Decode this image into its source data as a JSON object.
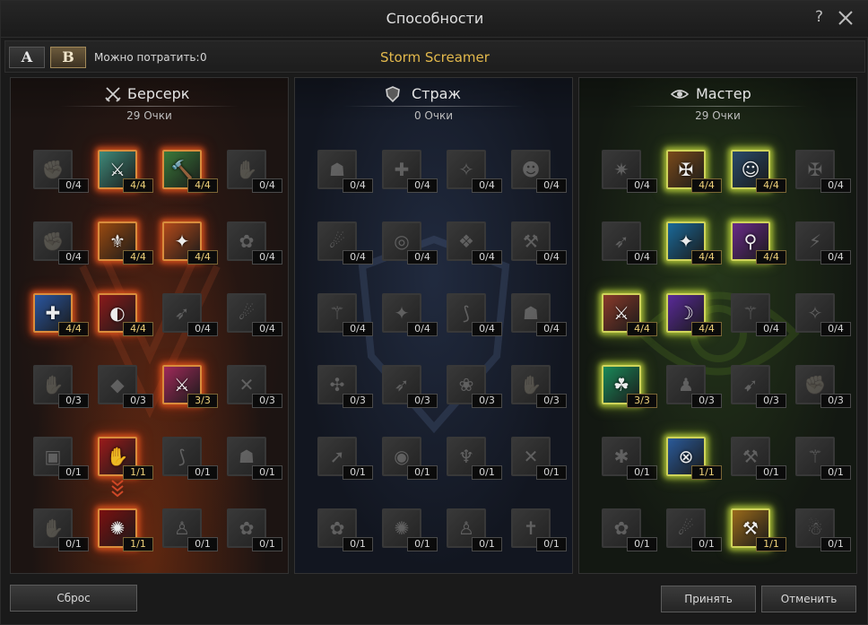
{
  "window": {
    "title": "Способности",
    "help": "?"
  },
  "toolbar": {
    "preset_a": "A",
    "preset_b": "B",
    "active_preset": "B",
    "spend_label": "Можно потратить:",
    "spend_value": "0",
    "spec_name": "Storm Screamer"
  },
  "panels": [
    {
      "key": "berserk",
      "title": "Берсерк",
      "points": "29 Очки",
      "emblem": "crossed-swords-icon",
      "accent": "#e0652a",
      "skills": [
        {
          "icon": "berserk-skill-1-icon",
          "glyph": "✊",
          "level": "0/4",
          "active": false
        },
        {
          "icon": "berserk-skill-2-icon",
          "glyph": "⚔",
          "level": "4/4",
          "active": true,
          "bg": "#3f8a7a"
        },
        {
          "icon": "berserk-skill-3-icon",
          "glyph": "🔨",
          "level": "4/4",
          "active": true,
          "bg": "#3a7a3a"
        },
        {
          "icon": "berserk-skill-4-icon",
          "glyph": "✋",
          "level": "0/4",
          "active": false
        },
        {
          "icon": "berserk-skill-5-icon",
          "glyph": "✊",
          "level": "0/4",
          "active": false
        },
        {
          "icon": "berserk-skill-6-icon",
          "glyph": "⚜",
          "level": "4/4",
          "active": true,
          "bg": "#9a4a10"
        },
        {
          "icon": "berserk-skill-7-icon",
          "glyph": "✦",
          "level": "4/4",
          "active": true,
          "bg": "#b34a1a"
        },
        {
          "icon": "berserk-skill-8-icon",
          "glyph": "✿",
          "level": "0/4",
          "active": false
        },
        {
          "icon": "berserk-skill-9-icon",
          "glyph": "✚",
          "level": "4/4",
          "active": true,
          "bg": "#2a56a0"
        },
        {
          "icon": "berserk-skill-10-icon",
          "glyph": "◐",
          "level": "4/4",
          "active": true,
          "bg": "#8a1a1a"
        },
        {
          "icon": "berserk-skill-11-icon",
          "glyph": "➶",
          "level": "0/4",
          "active": false
        },
        {
          "icon": "berserk-skill-12-icon",
          "glyph": "☄",
          "level": "0/4",
          "active": false
        },
        {
          "icon": "berserk-skill-13-icon",
          "glyph": "✋",
          "level": "0/3",
          "active": false
        },
        {
          "icon": "berserk-skill-14-icon",
          "glyph": "◆",
          "level": "0/3",
          "active": false
        },
        {
          "icon": "berserk-skill-15-icon",
          "glyph": "⚔",
          "level": "3/3",
          "active": true,
          "bg": "#a02a5a"
        },
        {
          "icon": "berserk-skill-16-icon",
          "glyph": "✕",
          "level": "0/3",
          "active": false
        },
        {
          "icon": "berserk-skill-17-icon",
          "glyph": "▣",
          "level": "0/1",
          "active": false
        },
        {
          "icon": "berserk-skill-18-icon",
          "glyph": "✋",
          "level": "1/1",
          "active": true,
          "bg": "#9a1a1a"
        },
        {
          "icon": "berserk-skill-19-icon",
          "glyph": "⟆",
          "level": "0/1",
          "active": false
        },
        {
          "icon": "berserk-skill-20-icon",
          "glyph": "☗",
          "level": "0/1",
          "active": false
        },
        {
          "icon": "berserk-skill-21-icon",
          "glyph": "✋",
          "level": "0/1",
          "active": false
        },
        {
          "icon": "berserk-skill-22-icon",
          "glyph": "✺",
          "level": "1/1",
          "active": true,
          "bg": "#7a1010"
        },
        {
          "icon": "berserk-skill-23-icon",
          "glyph": "♙",
          "level": "0/1",
          "active": false
        },
        {
          "icon": "berserk-skill-24-icon",
          "glyph": "✿",
          "level": "0/1",
          "active": false
        }
      ]
    },
    {
      "key": "guard",
      "title": "Страж",
      "points": "0 Очки",
      "emblem": "shield-icon",
      "accent": "#6f88b8",
      "skills": [
        {
          "icon": "guard-skill-1-icon",
          "glyph": "☗",
          "level": "0/4",
          "active": false
        },
        {
          "icon": "guard-skill-2-icon",
          "glyph": "✚",
          "level": "0/4",
          "active": false
        },
        {
          "icon": "guard-skill-3-icon",
          "glyph": "✧",
          "level": "0/4",
          "active": false
        },
        {
          "icon": "guard-skill-4-icon",
          "glyph": "☻",
          "level": "0/4",
          "active": false
        },
        {
          "icon": "guard-skill-5-icon",
          "glyph": "☄",
          "level": "0/4",
          "active": false
        },
        {
          "icon": "guard-skill-6-icon",
          "glyph": "◎",
          "level": "0/4",
          "active": false
        },
        {
          "icon": "guard-skill-7-icon",
          "glyph": "❖",
          "level": "0/4",
          "active": false
        },
        {
          "icon": "guard-skill-8-icon",
          "glyph": "⚒",
          "level": "0/4",
          "active": false
        },
        {
          "icon": "guard-skill-9-icon",
          "glyph": "⚚",
          "level": "0/4",
          "active": false
        },
        {
          "icon": "guard-skill-10-icon",
          "glyph": "✦",
          "level": "0/4",
          "active": false
        },
        {
          "icon": "guard-skill-11-icon",
          "glyph": "⟆",
          "level": "0/4",
          "active": false
        },
        {
          "icon": "guard-skill-12-icon",
          "glyph": "☗",
          "level": "0/4",
          "active": false
        },
        {
          "icon": "guard-skill-13-icon",
          "glyph": "✣",
          "level": "0/3",
          "active": false
        },
        {
          "icon": "guard-skill-14-icon",
          "glyph": "➶",
          "level": "0/3",
          "active": false
        },
        {
          "icon": "guard-skill-15-icon",
          "glyph": "❀",
          "level": "0/3",
          "active": false
        },
        {
          "icon": "guard-skill-16-icon",
          "glyph": "✋",
          "level": "0/3",
          "active": false
        },
        {
          "icon": "guard-skill-17-icon",
          "glyph": "➚",
          "level": "0/1",
          "active": false
        },
        {
          "icon": "guard-skill-18-icon",
          "glyph": "◉",
          "level": "0/1",
          "active": false
        },
        {
          "icon": "guard-skill-19-icon",
          "glyph": "♆",
          "level": "0/1",
          "active": false
        },
        {
          "icon": "guard-skill-20-icon",
          "glyph": "✕",
          "level": "0/1",
          "active": false
        },
        {
          "icon": "guard-skill-21-icon",
          "glyph": "✿",
          "level": "0/1",
          "active": false
        },
        {
          "icon": "guard-skill-22-icon",
          "glyph": "✺",
          "level": "0/1",
          "active": false
        },
        {
          "icon": "guard-skill-23-icon",
          "glyph": "♙",
          "level": "0/1",
          "active": false
        },
        {
          "icon": "guard-skill-24-icon",
          "glyph": "✝",
          "level": "0/1",
          "active": false
        }
      ]
    },
    {
      "key": "master",
      "title": "Мастер",
      "points": "29 Очки",
      "emblem": "eye-icon",
      "accent": "#b9cc4a",
      "skills": [
        {
          "icon": "master-skill-1-icon",
          "glyph": "✷",
          "level": "0/4",
          "active": false
        },
        {
          "icon": "master-skill-2-icon",
          "glyph": "✠",
          "level": "4/4",
          "active": true,
          "bg": "#7a4a1a"
        },
        {
          "icon": "master-skill-3-icon",
          "glyph": "☺",
          "level": "4/4",
          "active": true,
          "bg": "#2a4a6a"
        },
        {
          "icon": "master-skill-4-icon",
          "glyph": "✠",
          "level": "0/4",
          "active": false
        },
        {
          "icon": "master-skill-5-icon",
          "glyph": "➶",
          "level": "0/4",
          "active": false
        },
        {
          "icon": "master-skill-6-icon",
          "glyph": "✦",
          "level": "4/4",
          "active": true,
          "bg": "#1a6a9a"
        },
        {
          "icon": "master-skill-7-icon",
          "glyph": "⚲",
          "level": "4/4",
          "active": true,
          "bg": "#6a2a8a"
        },
        {
          "icon": "master-skill-8-icon",
          "glyph": "⚡",
          "level": "0/4",
          "active": false
        },
        {
          "icon": "master-skill-9-icon",
          "glyph": "⚔",
          "level": "4/4",
          "active": true,
          "bg": "#8a3a2a"
        },
        {
          "icon": "master-skill-10-icon",
          "glyph": "☽",
          "level": "4/4",
          "active": true,
          "bg": "#5a2a9a"
        },
        {
          "icon": "master-skill-11-icon",
          "glyph": "⚚",
          "level": "0/4",
          "active": false
        },
        {
          "icon": "master-skill-12-icon",
          "glyph": "✧",
          "level": "0/4",
          "active": false
        },
        {
          "icon": "master-skill-13-icon",
          "glyph": "☘",
          "level": "3/3",
          "active": true,
          "bg": "#1a8a5a"
        },
        {
          "icon": "master-skill-14-icon",
          "glyph": "♟",
          "level": "0/3",
          "active": false
        },
        {
          "icon": "master-skill-15-icon",
          "glyph": "➹",
          "level": "0/3",
          "active": false
        },
        {
          "icon": "master-skill-16-icon",
          "glyph": "✊",
          "level": "0/3",
          "active": false
        },
        {
          "icon": "master-skill-17-icon",
          "glyph": "✱",
          "level": "0/1",
          "active": false
        },
        {
          "icon": "master-skill-18-icon",
          "glyph": "⊗",
          "level": "1/1",
          "active": true,
          "bg": "#2a5a9a"
        },
        {
          "icon": "master-skill-19-icon",
          "glyph": "⚒",
          "level": "0/1",
          "active": false
        },
        {
          "icon": "master-skill-20-icon",
          "glyph": "⚚",
          "level": "0/1",
          "active": false
        },
        {
          "icon": "master-skill-21-icon",
          "glyph": "✿",
          "level": "0/1",
          "active": false
        },
        {
          "icon": "master-skill-22-icon",
          "glyph": "☄",
          "level": "0/1",
          "active": false
        },
        {
          "icon": "master-skill-23-icon",
          "glyph": "⚒",
          "level": "1/1",
          "active": true,
          "bg": "#9a6a1a"
        },
        {
          "icon": "master-skill-24-icon",
          "glyph": "☃",
          "level": "0/1",
          "active": false
        }
      ]
    }
  ],
  "footer": {
    "reset_label": "Сброс",
    "accept_label": "Принять",
    "cancel_label": "Отменить"
  }
}
